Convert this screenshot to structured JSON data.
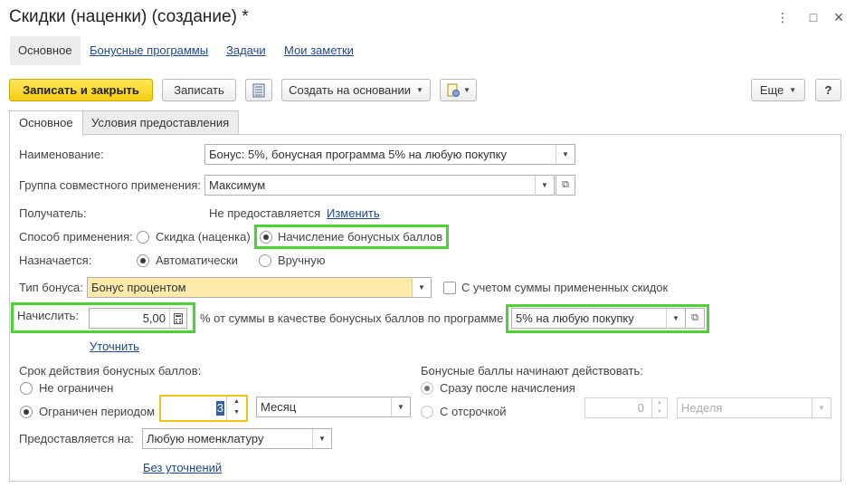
{
  "window": {
    "title": "Скидки (наценки) (создание) *",
    "menu_icon": "⋮",
    "restore_icon": "□",
    "close_icon": "×"
  },
  "nav": {
    "tabs": [
      {
        "label": "Основное"
      },
      {
        "label": "Бонусные программы"
      },
      {
        "label": "Задачи"
      },
      {
        "label": "Мои заметки"
      }
    ]
  },
  "toolbar": {
    "save_close_label": "Записать и закрыть",
    "save_label": "Записать",
    "create_based_label": "Создать на основании",
    "more_label": "Еще",
    "help_label": "?"
  },
  "tabs": [
    {
      "label": "Основное"
    },
    {
      "label": "Условия предоставления"
    }
  ],
  "form": {
    "name_label": "Наименование:",
    "name_value": "Бонус: 5%, бонусная программа 5% на любую покупку",
    "group_label": "Группа совместного применения:",
    "group_value": "Максимум",
    "recipient_label": "Получатель:",
    "recipient_value": "Не предоставляется",
    "recipient_change": "Изменить",
    "method_label": "Способ применения:",
    "method_option1": "Скидка (наценка)",
    "method_option2": "Начисление бонусных баллов",
    "assigned_label": "Назначается:",
    "assigned_option1": "Автоматически",
    "assigned_option2": "Вручную",
    "bonus_type_label": "Тип бонуса:",
    "bonus_type_value": "Бонус процентом",
    "consider_discounts_label": "С учетом суммы примененных скидок",
    "accrue_label": "Начислить:",
    "accrue_value": "5,00",
    "accrue_suffix": "% от суммы в качестве бонусных баллов по программе",
    "program_value": "5% на любую покупку",
    "refine_link": "Уточнить",
    "validity_label": "Срок действия бонусных баллов:",
    "validity_option1": "Не ограничен",
    "validity_option2": "Ограничен периодом",
    "period_count": "3",
    "period_unit": "Месяц",
    "start_label": "Бонусные баллы начинают действовать:",
    "start_option1": "Сразу после начисления",
    "start_option2": "С отсрочкой",
    "delay_value": "0",
    "delay_unit": "Неделя",
    "provided_on_label": "Предоставляется на:",
    "provided_on_value": "Любую номенклатуру",
    "no_refinement_link": "Без уточнений"
  },
  "colors": {
    "highlight": "#4cd137",
    "primary_button": "#f5cc12",
    "bonus_type_field": "#fbeaaa",
    "link": "#1c4a8a"
  }
}
